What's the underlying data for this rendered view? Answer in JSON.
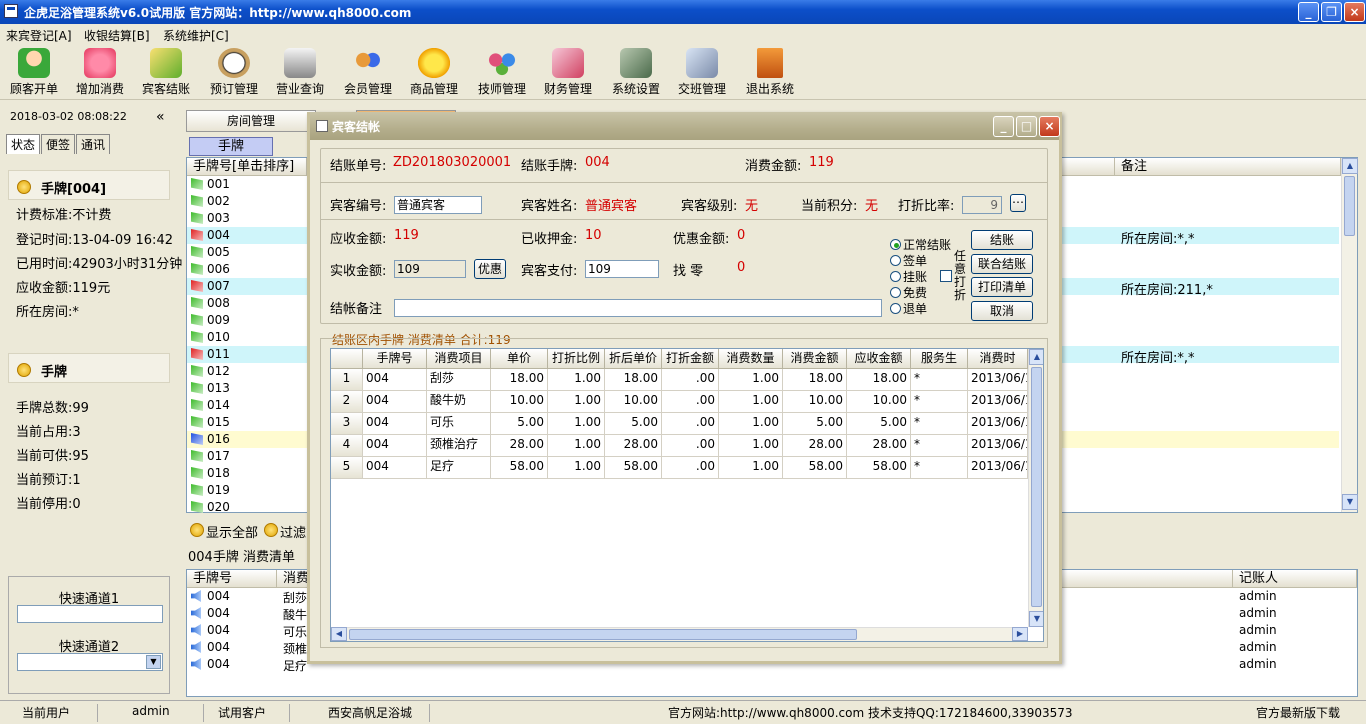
{
  "app": {
    "title": "企虎足浴管理系统v6.0试用版 官方网站：http://www.qh8000.com"
  },
  "menus": [
    "来宾登记[A]",
    "收银结算[B]",
    "系统维护[C]"
  ],
  "toolbar": [
    "顾客开单",
    "增加消费",
    "宾客结账",
    "预订管理",
    "营业查询",
    "会员管理",
    "商品管理",
    "技师管理",
    "财务管理",
    "系统设置",
    "交班管理",
    "退出系统"
  ],
  "left": {
    "datetime": "2018-03-02 08:08:22",
    "collapse": "«",
    "tabs": [
      "状态",
      "便签",
      "通讯"
    ],
    "card_title": "手牌[004]",
    "card_lines": [
      "计费标准:不计费",
      "登记时间:13-04-09 16:42",
      "已用时间:42903小时31分钟",
      "应收金额:119元",
      "所在房间:*"
    ],
    "stat_title": "手牌",
    "stat_lines": [
      "手牌总数:99",
      "当前占用:3",
      "当前可供:95",
      "当前预订:1",
      "当前停用:0"
    ],
    "quick1": "快速通道1",
    "quick2": "快速通道2"
  },
  "main": {
    "tab1": "房间管理",
    "subtab": "手牌",
    "col_main": "手牌号[单击排序]",
    "col_note": "备注",
    "rows": [
      {
        "no": "001",
        "status": "green",
        "note": ""
      },
      {
        "no": "002",
        "status": "green",
        "note": ""
      },
      {
        "no": "003",
        "status": "green",
        "note": ""
      },
      {
        "no": "004",
        "status": "red",
        "note": "所在房间:*,*"
      },
      {
        "no": "005",
        "status": "green",
        "note": ""
      },
      {
        "no": "006",
        "status": "green",
        "note": ""
      },
      {
        "no": "007",
        "status": "red",
        "note": "所在房间:211,*"
      },
      {
        "no": "008",
        "status": "green",
        "note": ""
      },
      {
        "no": "009",
        "status": "green",
        "note": ""
      },
      {
        "no": "010",
        "status": "green",
        "note": ""
      },
      {
        "no": "011",
        "status": "red",
        "note": "所在房间:*,*"
      },
      {
        "no": "012",
        "status": "green",
        "note": ""
      },
      {
        "no": "013",
        "status": "green",
        "note": ""
      },
      {
        "no": "014",
        "status": "green",
        "note": ""
      },
      {
        "no": "015",
        "status": "green",
        "note": ""
      },
      {
        "no": "016",
        "status": "blue",
        "note": ""
      },
      {
        "no": "017",
        "status": "green",
        "note": ""
      },
      {
        "no": "018",
        "status": "green",
        "note": ""
      },
      {
        "no": "019",
        "status": "green",
        "note": ""
      },
      {
        "no": "020",
        "status": "green",
        "note": ""
      }
    ],
    "show_all": "显示全部",
    "filter": "过滤",
    "sub_label": "004手牌  消费清单",
    "bottom_cols": [
      "手牌号",
      "消费",
      "",
      "记账人"
    ],
    "bottom_rows": [
      {
        "no": "004",
        "item": "刮莎",
        "user": "admin"
      },
      {
        "no": "004",
        "item": "酸牛",
        "user": "admin"
      },
      {
        "no": "004",
        "item": "可乐",
        "user": "admin"
      },
      {
        "no": "004",
        "item": "颈椎",
        "user": "admin"
      },
      {
        "no": "004",
        "item": "足疗",
        "user": "admin"
      }
    ]
  },
  "dialog": {
    "title": "宾客结帐",
    "bill_label": "结账单号:",
    "bill_value": "ZD201803020001",
    "card_label": "结账手牌:",
    "card_value": "004",
    "amount_label": "消费金额:",
    "amount_value": "119",
    "guest_no_label": "宾客编号:",
    "guest_no_value": "普通宾客",
    "guest_name_label": "宾客姓名:",
    "guest_name_value": "普通宾客",
    "guest_level_label": "宾客级别:",
    "guest_level_value": "无",
    "points_label": "当前积分:",
    "points_value": "无",
    "discount_label": "打折比率:",
    "discount_value": "9",
    "receivable_label": "应收金额:",
    "receivable_value": "119",
    "deposit_label": "已收押金:",
    "deposit_value": "10",
    "promo_label": "优惠金额:",
    "promo_value": "0",
    "actual_label": "实收金额:",
    "actual_value": "109",
    "promo_btn": "优惠",
    "pay_label": "宾客支付:",
    "pay_value": "109",
    "change_label": "找  零",
    "change_value": "0",
    "remark_label": "结帐备注",
    "radios": [
      "正常结账",
      "签单",
      "挂账",
      "免费",
      "退单"
    ],
    "any_discount": "任意打折",
    "buttons": [
      "结账",
      "联合结账",
      "打印清单",
      "取消"
    ],
    "list_title": "结账区内手牌  消费清单  合计:119",
    "grid_cols": [
      "",
      "手牌号",
      "消费项目",
      "单价",
      "打折比例",
      "折后单价",
      "打折金额",
      "消费数量",
      "消费金额",
      "应收金额",
      "服务生",
      "消费时"
    ],
    "grid_rows": [
      [
        "1",
        "004",
        "刮莎",
        "18.00",
        "1.00",
        "18.00",
        ".00",
        "1.00",
        "18.00",
        "18.00",
        "*",
        "2013/06/1"
      ],
      [
        "2",
        "004",
        "酸牛奶",
        "10.00",
        "1.00",
        "10.00",
        ".00",
        "1.00",
        "10.00",
        "10.00",
        "*",
        "2013/06/1"
      ],
      [
        "3",
        "004",
        "可乐",
        "5.00",
        "1.00",
        "5.00",
        ".00",
        "1.00",
        "5.00",
        "5.00",
        "*",
        "2013/06/1"
      ],
      [
        "4",
        "004",
        "颈椎治疗",
        "28.00",
        "1.00",
        "28.00",
        ".00",
        "1.00",
        "28.00",
        "28.00",
        "*",
        "2013/06/1"
      ],
      [
        "5",
        "004",
        "足疗",
        "58.00",
        "1.00",
        "58.00",
        ".00",
        "1.00",
        "58.00",
        "58.00",
        "*",
        "2013/06/1"
      ]
    ]
  },
  "status": {
    "user_label": "当前用户",
    "user": "admin",
    "customer_label": "试用客户",
    "customer": "西安高帆足浴城",
    "site": "官方网站:http://www.qh8000.com 技术支持QQ:172184600,33903573",
    "download": "官方最新版下载"
  },
  "colors": {
    "title_blue": "#0c4fc9",
    "accent_red": "#d40000",
    "row_highlight": "#cff5fa",
    "row_selected": "#fffbd0"
  }
}
